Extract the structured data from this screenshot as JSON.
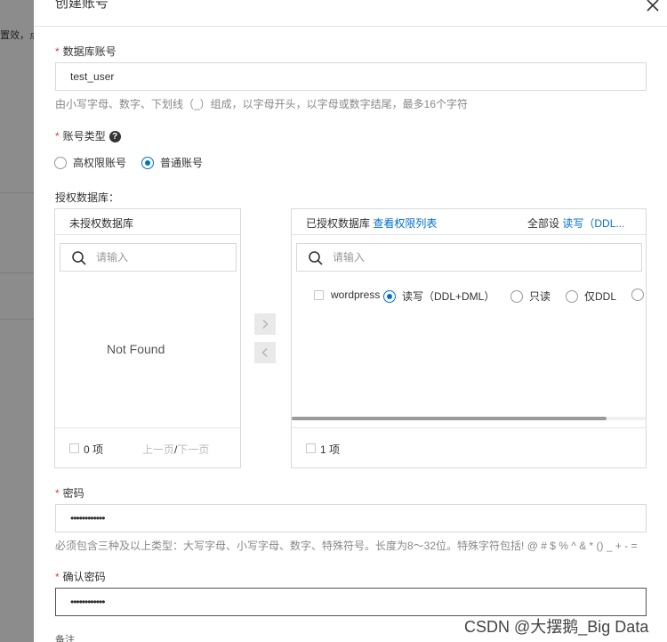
{
  "backdrop": {
    "text": "置效，点"
  },
  "drawer": {
    "title": "创建账号"
  },
  "db_account": {
    "label": "数据库账号",
    "value": "test_user",
    "help": "由小写字母、数字、下划线（_）组成，以字母开头，以字母或数字结尾，最多16个字符"
  },
  "account_type": {
    "label": "账号类型",
    "options": [
      "高权限账号",
      "普通账号"
    ],
    "selected": "普通账号"
  },
  "authorized_db": {
    "label": "授权数据库：",
    "unauth_panel": {
      "title": "未授权数据库",
      "search_placeholder": "请输入",
      "empty_text": "Not Found",
      "count": "0 项",
      "prev": "上一页",
      "slash": "/",
      "next": "下一页"
    },
    "auth_panel": {
      "title": "已授权数据库",
      "link": "查看权限列表",
      "set_all_label": "全部设",
      "set_all_link": "读写（DDL...",
      "search_placeholder": "请输入",
      "item_name": "wordpress",
      "perms": [
        "读写（DDL+DML）",
        "只读",
        "仅DDL"
      ],
      "selected_perm": "读写（DDL+DML）",
      "count": "1 项"
    },
    "scroll_position": 0.89
  },
  "password": {
    "label": "密码",
    "value": "••••••••••••",
    "help": "必须包含三种及以上类型：大写字母、小写字母、数字、特殊符号。长度为8～32位。特殊字符包括! @ # $ % ^ & * () _ + - ="
  },
  "confirm_password": {
    "label": "确认密码",
    "value": "••••••••••••"
  },
  "remark": {
    "label": "备注"
  },
  "watermark": "CSDN @大摆鹅_Big Data",
  "colors": {
    "accent": "#0070cc",
    "required": "#e23b3b"
  }
}
